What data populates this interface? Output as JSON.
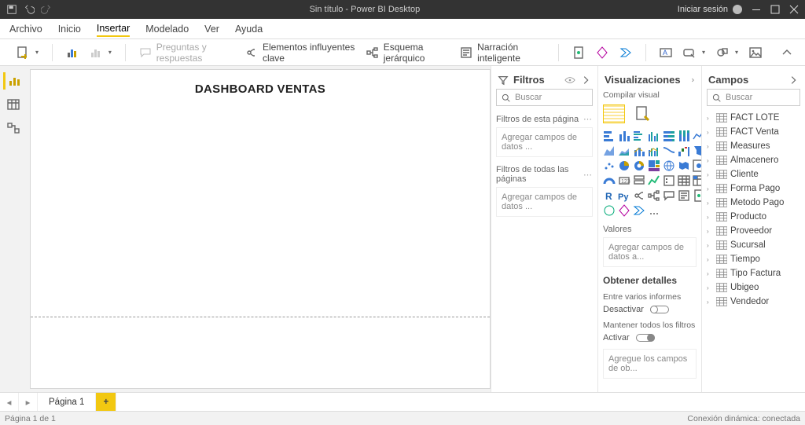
{
  "titlebar": {
    "title": "Sin título - Power BI Desktop",
    "signin": "Iniciar sesión"
  },
  "menu": {
    "items": [
      "Archivo",
      "Inicio",
      "Insertar",
      "Modelado",
      "Ver",
      "Ayuda"
    ],
    "active_index": 2
  },
  "ribbon": {
    "qa_label": "Preguntas y respuestas",
    "key_influencers": "Elementos influyentes clave",
    "decomp_tree": "Esquema jerárquico",
    "smart_narrative": "Narración inteligente"
  },
  "report": {
    "title": "DASHBOARD VENTAS"
  },
  "filters": {
    "title": "Filtros",
    "search_placeholder": "Buscar",
    "page_filters_label": "Filtros de esta página",
    "all_pages_label": "Filtros de todas las páginas",
    "drop_hint": "Agregar campos de datos ..."
  },
  "visualizations": {
    "title": "Visualizaciones",
    "subtitle": "Compilar visual",
    "values_label": "Valores",
    "values_hint": "Agregar campos de datos a...",
    "drill_label": "Obtener detalles",
    "cross_label": "Entre varios informes",
    "off_label": "Desactivar",
    "keep_filters_label": "Mantener todos los filtros",
    "on_label": "Activar",
    "drill_hint": "Agregue los campos de ob..."
  },
  "fields": {
    "title": "Campos",
    "search_placeholder": "Buscar",
    "tables": [
      "FACT LOTE",
      "FACT Venta",
      "Measures",
      "Almacenero",
      "Cliente",
      "Forma Pago",
      "Metodo Pago",
      "Producto",
      "Proveedor",
      "Sucursal",
      "Tiempo",
      "Tipo Factura",
      "Ubigeo",
      "Vendedor"
    ]
  },
  "tabs": {
    "page1": "Página 1"
  },
  "status": {
    "page": "Página 1 de 1",
    "conn": "Conexión dinámica: conectada"
  }
}
